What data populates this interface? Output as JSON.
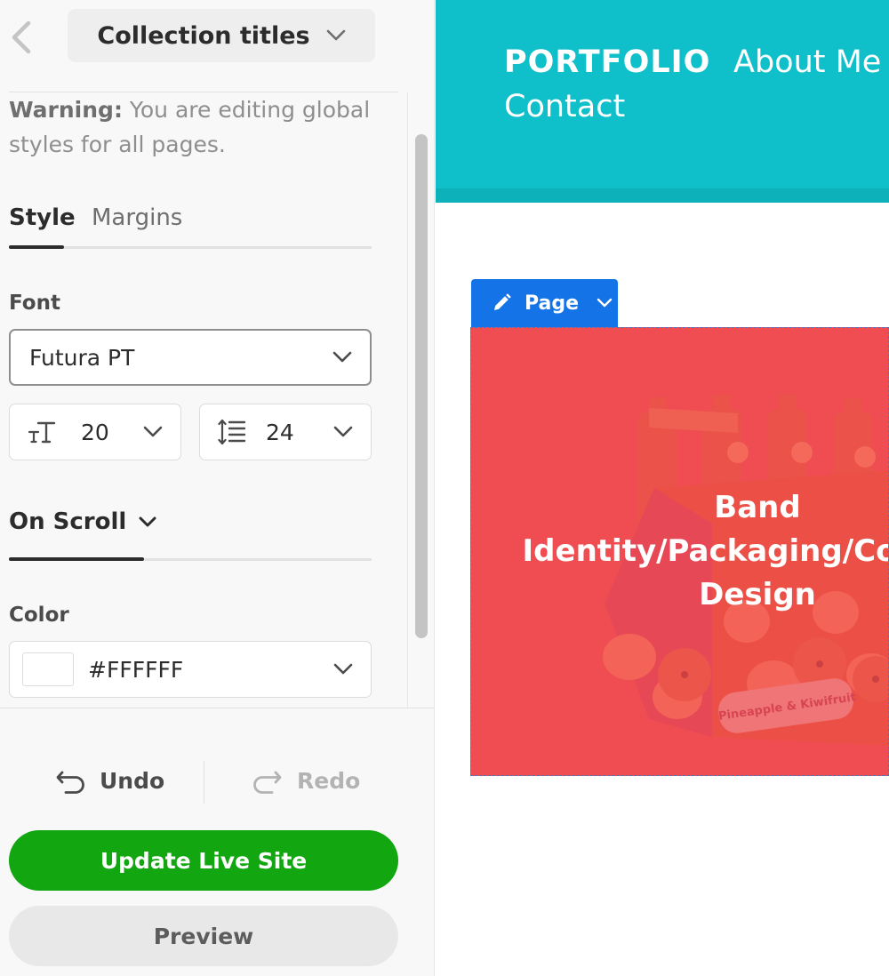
{
  "panel": {
    "title": "Collection titles",
    "warning_label": "Warning:",
    "warning_text": " You are editing global styles for all pages.",
    "tabs": [
      {
        "label": "Style",
        "active": true
      },
      {
        "label": "Margins",
        "active": false
      }
    ],
    "font": {
      "label": "Font",
      "value": "Futura PT"
    },
    "font_size": {
      "value": "20"
    },
    "line_height": {
      "value": "24"
    },
    "on_scroll": {
      "label": "On Scroll"
    },
    "color": {
      "label": "Color",
      "value": "#FFFFFF",
      "swatch": "#FFFFFF"
    },
    "undo_label": "Undo",
    "redo_label": "Redo",
    "update_label": "Update Live Site",
    "preview_label": "Preview"
  },
  "site": {
    "brand": "PORTFOLIO",
    "nav": [
      "About Me",
      "Contact"
    ],
    "page_tab_label": "Page",
    "project_title": "Band\nIdentity/Packaging/Concept\nDesign",
    "project_art_text": "Pineapple & Kiwifruit"
  },
  "colors": {
    "header": "#0fbfc9",
    "update_button": "#12a610",
    "page_tab": "#1473e6",
    "project_overlay": "#f04e54"
  },
  "icons": {
    "back": "chevron-left-icon",
    "dropdown": "chevron-down-icon",
    "font_size": "text-size-icon",
    "line_height": "line-height-icon",
    "undo": "undo-icon",
    "redo": "redo-icon",
    "edit": "pencil-icon"
  }
}
